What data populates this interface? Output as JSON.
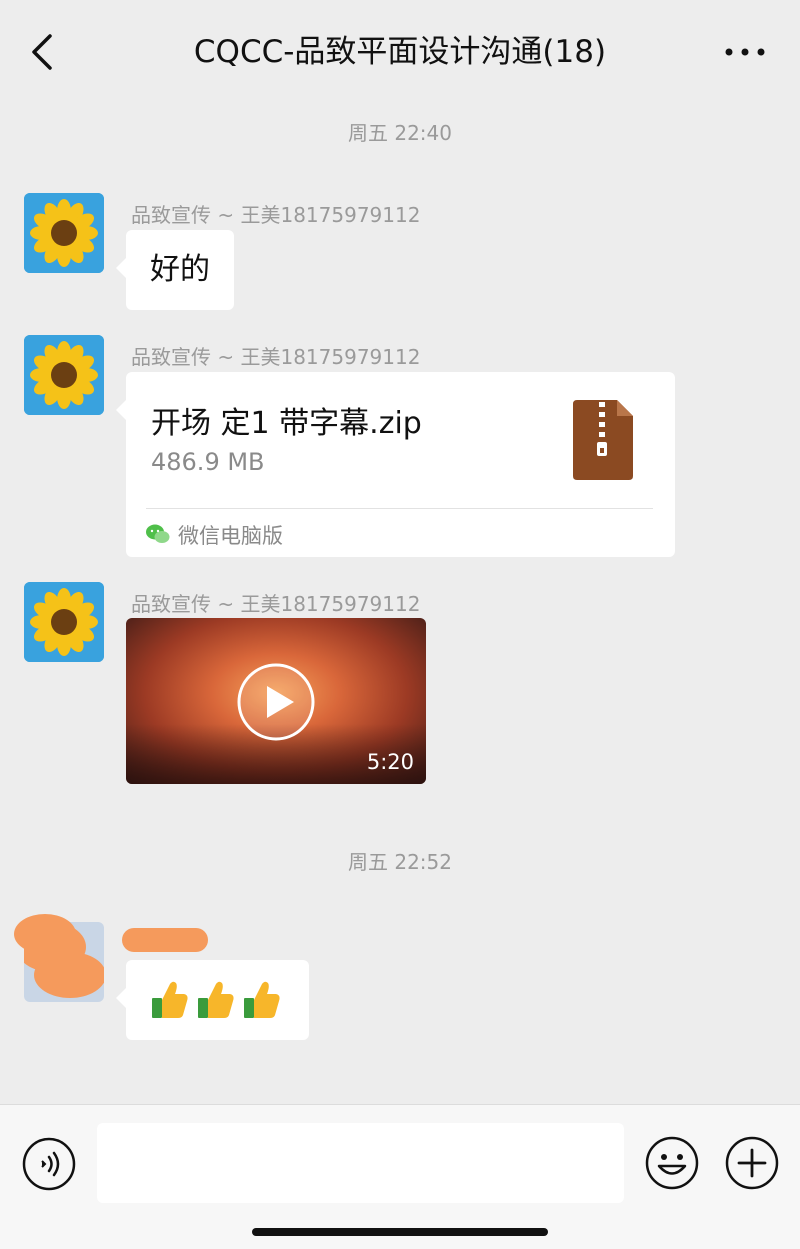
{
  "header": {
    "title": "CQCC-品致平面设计沟通(18)",
    "back_icon": "chevron-left-icon",
    "more_icon": "more-dots-icon"
  },
  "timestamps": [
    "周五 22:40",
    "周五 22:52"
  ],
  "messages": [
    {
      "sender": "品致宣传 ~ 王美18175979112",
      "type": "text",
      "text": "好的"
    },
    {
      "sender": "品致宣传 ~ 王美18175979112",
      "type": "file",
      "file_name": "开场 定1 带字幕.zip",
      "file_size": "486.9 MB",
      "source": "微信电脑版",
      "icon": "zip-file-icon"
    },
    {
      "sender": "品致宣传 ~ 王美18175979112",
      "type": "video",
      "duration": "5:20",
      "icon": "play-icon"
    },
    {
      "sender": "",
      "type": "emoji",
      "emoji": [
        "👍",
        "👍",
        "👍"
      ]
    }
  ],
  "input_bar": {
    "placeholder": "",
    "voice_icon": "voice-icon",
    "emoji_icon": "emoji-icon",
    "plus_icon": "plus-icon"
  },
  "colors": {
    "background": "#ededed",
    "bubble": "#ffffff",
    "meta_text": "#9a9a9a",
    "zip_brown": "#8b4a22"
  }
}
